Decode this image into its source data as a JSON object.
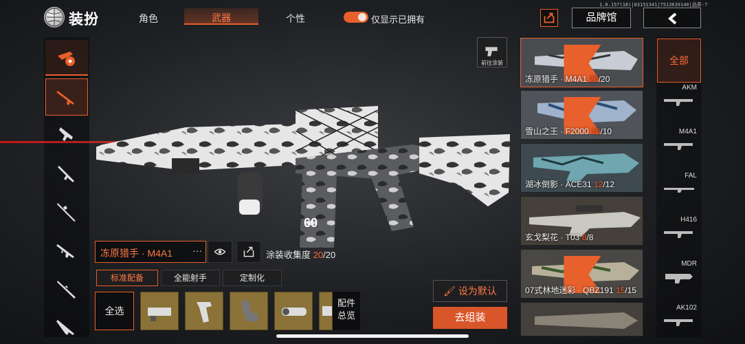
{
  "header": {
    "title": "装扮",
    "tabs": [
      "角色",
      "武器",
      "个性"
    ],
    "active_tab": "武器",
    "toggle_label": "仅显示已拥有",
    "toggle_on": true,
    "version_text": "1.0.157(18)|03151341|7513639140|品质-7",
    "brand_button": "品牌馆"
  },
  "goto_paint_label": "前往涂装",
  "weapon": {
    "name": "冻原猎手 · M4A1",
    "more": "···",
    "collection_label": "涂装收集度",
    "collection_have": "20",
    "collection_total": "/20"
  },
  "subtabs": [
    "标准配备",
    "全能射手",
    "定制化"
  ],
  "parts": {
    "select_all": "全选",
    "overview_line1": "配件",
    "overview_line2": "总览"
  },
  "actions": {
    "set_default": "设为默认",
    "go_assemble": "去组装"
  },
  "skins": [
    {
      "name": "冻原猎手 · M4A1 ",
      "have": "20",
      "total": "/20"
    },
    {
      "name": "雪山之王 · F2000 ",
      "have": "10",
      "total": "/10"
    },
    {
      "name": "湖冰倒影 · ACE31 ",
      "have": "12",
      "total": "/12"
    },
    {
      "name": "玄戈梨花 · T03 ",
      "have": "8",
      "total": "/8"
    },
    {
      "name": "07式林地迷彩 · QBZ191 ",
      "have": "15",
      "total": "/15"
    }
  ],
  "right_categories": {
    "all": "全部",
    "items": [
      "AKM",
      "M4A1",
      "FAL",
      "H416",
      "MDR",
      "AK102"
    ]
  },
  "colors": {
    "accent": "#e8602c",
    "owned": "#ff5a2a",
    "part_bg": "#8a7238"
  }
}
